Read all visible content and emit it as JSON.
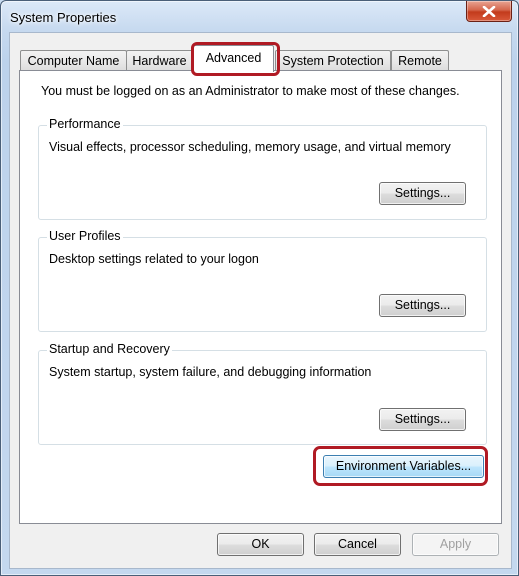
{
  "window": {
    "title": "System Properties"
  },
  "tabs": [
    {
      "label": "Computer Name",
      "active": false
    },
    {
      "label": "Hardware",
      "active": false
    },
    {
      "label": "Advanced",
      "active": true
    },
    {
      "label": "System Protection",
      "active": false
    },
    {
      "label": "Remote",
      "active": false
    }
  ],
  "advanced": {
    "intro": "You must be logged on as an Administrator to make most of these changes.",
    "performance": {
      "title": "Performance",
      "description": "Visual effects, processor scheduling, memory usage, and virtual memory",
      "button": "Settings..."
    },
    "user_profiles": {
      "title": "User Profiles",
      "description": "Desktop settings related to your logon",
      "button": "Settings..."
    },
    "startup_recovery": {
      "title": "Startup and Recovery",
      "description": "System startup, system failure, and debugging information",
      "button": "Settings..."
    },
    "environment_button": "Environment Variables..."
  },
  "footer": {
    "ok": "OK",
    "cancel": "Cancel",
    "apply": "Apply"
  },
  "highlight_color": "#b01a24"
}
